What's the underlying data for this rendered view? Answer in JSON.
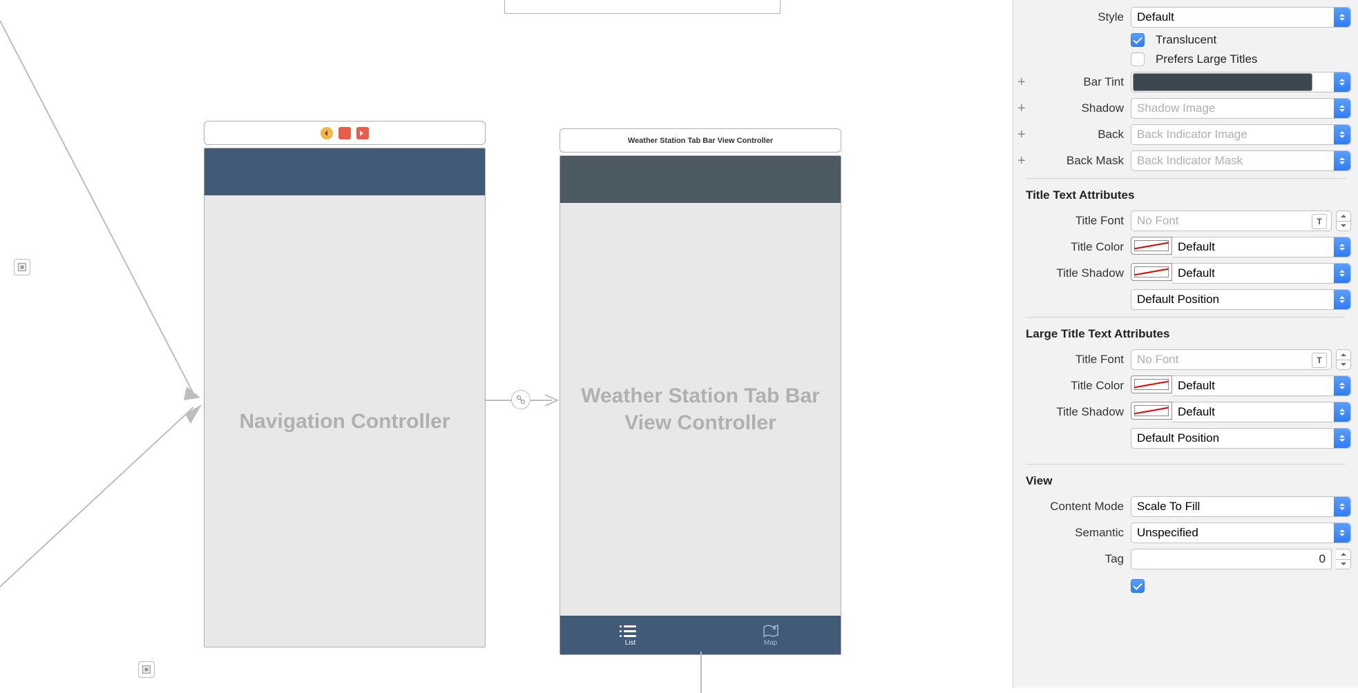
{
  "canvas": {
    "scene1": {
      "title": "Navigation Controller"
    },
    "scene2": {
      "titlebar": "Weather Station Tab Bar View Controller",
      "body_title": "Weather Station Tab Bar View Controller",
      "tabs": [
        {
          "label": "List",
          "active": true
        },
        {
          "label": "Map",
          "active": false
        }
      ]
    }
  },
  "inspector": {
    "style": {
      "label": "Style",
      "value": "Default"
    },
    "translucent": {
      "label": "Translucent",
      "checked": true
    },
    "prefers_large": {
      "label": "Prefers Large Titles",
      "checked": false
    },
    "bar_tint": {
      "label": "Bar Tint",
      "color": "#3c4850"
    },
    "shadow": {
      "label": "Shadow",
      "placeholder": "Shadow Image"
    },
    "back": {
      "label": "Back",
      "placeholder": "Back Indicator Image"
    },
    "back_mask": {
      "label": "Back Mask",
      "placeholder": "Back Indicator Mask"
    },
    "title_attrs": {
      "header": "Title Text Attributes",
      "font": {
        "label": "Title Font",
        "placeholder": "No Font"
      },
      "color": {
        "label": "Title Color",
        "value": "Default"
      },
      "shadow": {
        "label": "Title Shadow",
        "value": "Default"
      },
      "position": {
        "value": "Default Position"
      }
    },
    "large_title_attrs": {
      "header": "Large Title Text Attributes",
      "font": {
        "label": "Title Font",
        "placeholder": "No Font"
      },
      "color": {
        "label": "Title Color",
        "value": "Default"
      },
      "shadow": {
        "label": "Title Shadow",
        "value": "Default"
      },
      "position": {
        "value": "Default Position"
      }
    },
    "view": {
      "header": "View",
      "content_mode": {
        "label": "Content Mode",
        "value": "Scale To Fill"
      },
      "semantic": {
        "label": "Semantic",
        "value": "Unspecified"
      },
      "tag": {
        "label": "Tag",
        "value": "0"
      }
    }
  }
}
